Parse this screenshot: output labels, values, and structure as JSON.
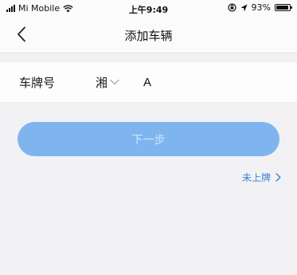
{
  "status_bar": {
    "carrier": "Mi Mobile",
    "time": "上午9:49",
    "battery_percent": "93%",
    "battery_level": 0.93,
    "icons": [
      "signal-icon",
      "wifi-icon",
      "screen-rotation-lock-icon",
      "location-arrow-icon",
      "battery-icon"
    ]
  },
  "nav": {
    "title": "添加车辆",
    "back_icon": "chevron-left-icon"
  },
  "form": {
    "plate_label": "车牌号",
    "province_value": "湘",
    "province_icon": "chevron-down-icon",
    "plate_value": "A",
    "plate_placeholder": ""
  },
  "actions": {
    "next_label": "下一步",
    "unregistered_label": "未上牌",
    "unregistered_icon": "chevron-right-icon"
  },
  "colors": {
    "accent": "#7eb5ef",
    "link": "#3d7fd9",
    "background": "#f2f2f4"
  }
}
